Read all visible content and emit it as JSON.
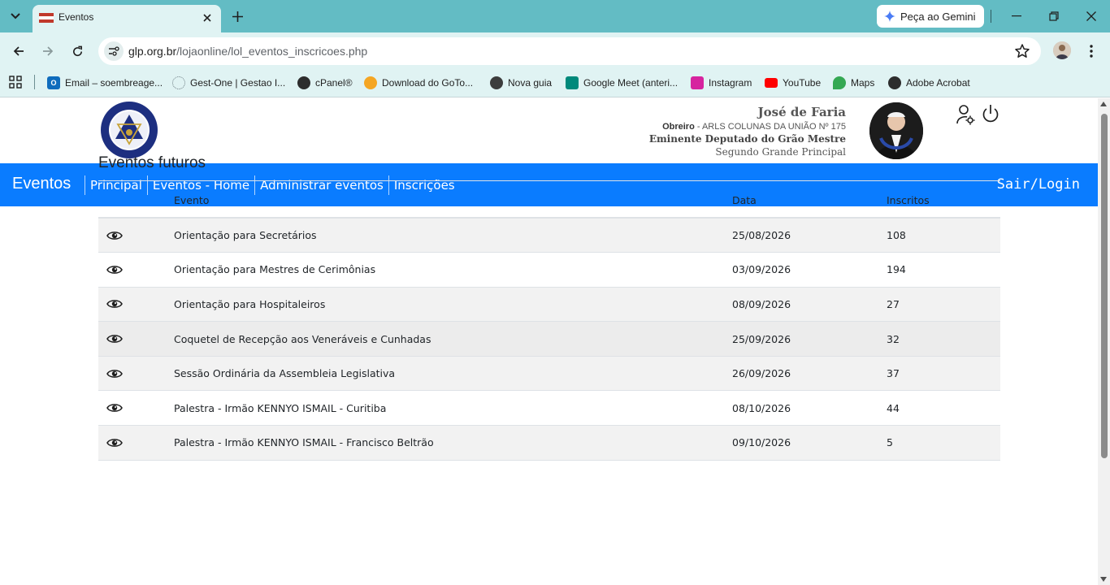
{
  "browser": {
    "tab_title": "Eventos",
    "gemini_label": "Peça ao Gemini",
    "url_host": "glp.org.br",
    "url_path": "/lojaonline/lol_eventos_inscricoes.php",
    "bookmarks": [
      {
        "label": "Email – soembreage...",
        "icon": "outlook-icon"
      },
      {
        "label": "Gest-One | Gestao I...",
        "icon": "loading-icon"
      },
      {
        "label": "cPanel®",
        "icon": "globe-icon"
      },
      {
        "label": "Download do GoTo...",
        "icon": "goto-icon"
      },
      {
        "label": "Nova guia",
        "icon": "chrome-icon"
      },
      {
        "label": "Google Meet (anteri...",
        "icon": "meet-icon"
      },
      {
        "label": "Instagram",
        "icon": "instagram-icon"
      },
      {
        "label": "YouTube",
        "icon": "youtube-icon"
      },
      {
        "label": "Maps",
        "icon": "maps-icon"
      },
      {
        "label": "Adobe Acrobat",
        "icon": "globe-icon"
      }
    ]
  },
  "header": {
    "user_name": "José de Faria",
    "role_label": "Obreiro",
    "lodge": " - ARLS COLUNAS DA UNIÃO Nº 175",
    "title_line": "Eminente Deputado do Grão Mestre",
    "subtitle_line": "Segundo Grande Principal"
  },
  "nav": {
    "brand": "Eventos",
    "items": [
      "Principal",
      "Eventos - Home",
      "Administrar eventos",
      "Inscrições"
    ],
    "sair": "Sair/Login"
  },
  "main": {
    "section_title": "Eventos futuros",
    "columns": [
      "Evento",
      "Data",
      "Inscritos"
    ],
    "rows": [
      {
        "evento": "Orientação para Secretários",
        "data": "25/08/2026",
        "inscritos": "108"
      },
      {
        "evento": "Orientação para Mestres de Cerimônias",
        "data": "03/09/2026",
        "inscritos": "194"
      },
      {
        "evento": "Orientação para Hospitaleiros",
        "data": "08/09/2026",
        "inscritos": "27"
      },
      {
        "evento": "Coquetel de Recepção aos Veneráveis e Cunhadas",
        "data": "25/09/2026",
        "inscritos": "32"
      },
      {
        "evento": "Sessão Ordinária da Assembleia Legislativa",
        "data": "26/09/2026",
        "inscritos": "37"
      },
      {
        "evento": "Palestra - Irmão KENNYO ISMAIL - Curitiba",
        "data": "08/10/2026",
        "inscritos": "44"
      },
      {
        "evento": "Palestra - Irmão KENNYO ISMAIL - Francisco Beltrão",
        "data": "09/10/2026",
        "inscritos": "5"
      }
    ]
  },
  "colors": {
    "navbar": "#0a7cff",
    "chrome": "#63bcc4",
    "toolbar": "#e0f3f3"
  }
}
